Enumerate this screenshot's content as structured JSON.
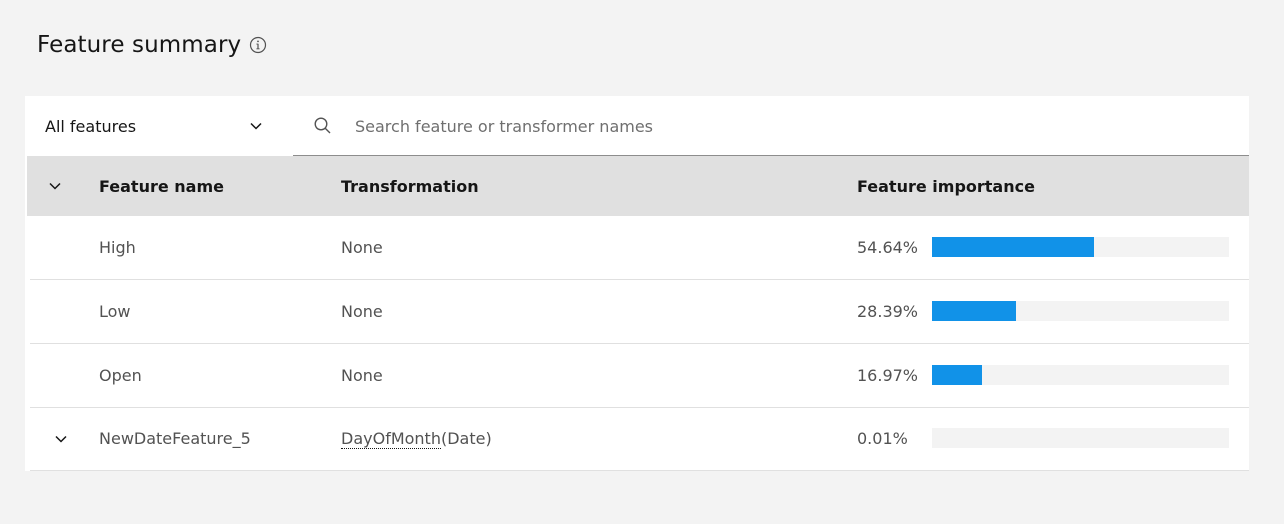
{
  "header": {
    "title": "Feature summary",
    "info_icon": "information-icon"
  },
  "toolbar": {
    "filter_value": "All features",
    "search_placeholder": "Search feature or transformer names"
  },
  "table": {
    "columns": [
      "Feature name",
      "Transformation",
      "Feature importance"
    ],
    "rows": [
      {
        "name": "High",
        "transformation": "None",
        "transform_fn": "",
        "transform_arg": "",
        "importance_label": "54.64%",
        "importance": 0.5464,
        "expandable": false
      },
      {
        "name": "Low",
        "transformation": "None",
        "transform_fn": "",
        "transform_arg": "",
        "importance_label": "28.39%",
        "importance": 0.2839,
        "expandable": false
      },
      {
        "name": "Open",
        "transformation": "None",
        "transform_fn": "",
        "transform_arg": "",
        "importance_label": "16.97%",
        "importance": 0.1697,
        "expandable": false
      },
      {
        "name": "NewDateFeature_5",
        "transformation": "",
        "transform_fn": "DayOfMonth",
        "transform_arg": "(Date)",
        "importance_label": "0.01%",
        "importance": 0.0001,
        "expandable": true
      }
    ]
  },
  "colors": {
    "bar": "#1192e8",
    "track": "#f3f3f3",
    "header_bg": "#e0e0e0",
    "page_bg": "#f3f3f3"
  }
}
